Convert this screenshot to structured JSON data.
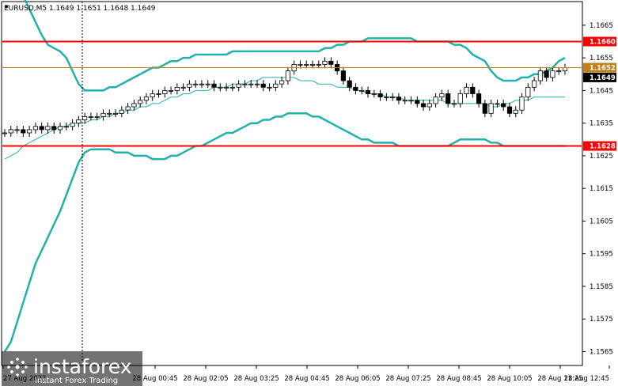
{
  "header": {
    "symbol_info": "EURUSD,M5  1.1649 1.1651 1.1648 1.1649"
  },
  "watermark": {
    "brand": "instaforex",
    "tagline": "Instant Forex Trading"
  },
  "colors": {
    "background": "#ffffff",
    "candle": "#000000",
    "bollinger": "#20b2aa",
    "moving_average": "#20b2aa",
    "level_line": "#ff0000",
    "current_price_line": "#c0801a",
    "grid_tick": "#000000",
    "price_box_text": "#ffffff",
    "current_box_bg": "#000000"
  },
  "chart_data": {
    "type": "candlestick",
    "symbol": "EURUSD",
    "timeframe": "M5",
    "ylim": [
      1.1561,
      1.1672
    ],
    "y_ticks": [
      "1.1665",
      "1.1655",
      "1.1645",
      "1.1635",
      "1.1625",
      "1.1615",
      "1.1605",
      "1.1595",
      "1.1585",
      "1.1575",
      "1.1565"
    ],
    "x_tick_labels": [
      "27 Aug 2022",
      "28 Aug 00:45",
      "28 Aug 02:05",
      "28 Aug 03:25",
      "28 Aug 04:45",
      "28 Aug 06:05",
      "28 Aug 07:25",
      "28 Aug 08:45",
      "28 Aug 10:05",
      "28 Aug 11:25",
      "28 Aug 12:45"
    ],
    "levels": [
      {
        "label": "1.1660",
        "value": 1.166
      },
      {
        "label": "1.1628",
        "value": 1.1628
      }
    ],
    "current_level": {
      "label": "1.1652",
      "value": 1.1652
    },
    "current_price": {
      "label": "1.1649",
      "value": 1.1649
    },
    "close": [
      1.1632,
      1.1633,
      1.1633,
      1.1632,
      1.1633,
      1.1634,
      1.1633,
      1.1634,
      1.1633,
      1.1634,
      1.1634,
      1.1635,
      1.1636,
      1.1637,
      1.1637,
      1.1637,
      1.1638,
      1.1638,
      1.1638,
      1.1639,
      1.164,
      1.1641,
      1.1642,
      1.1643,
      1.1644,
      1.1644,
      1.1645,
      1.1645,
      1.1646,
      1.1646,
      1.1647,
      1.1647,
      1.1647,
      1.1647,
      1.1646,
      1.1646,
      1.1646,
      1.1646,
      1.1647,
      1.1647,
      1.1647,
      1.1647,
      1.1646,
      1.1646,
      1.1647,
      1.1648,
      1.1651,
      1.1653,
      1.1653,
      1.1653,
      1.1653,
      1.1653,
      1.1654,
      1.1653,
      1.1651,
      1.1648,
      1.1646,
      1.1645,
      1.1645,
      1.1644,
      1.1644,
      1.1643,
      1.1643,
      1.1643,
      1.1642,
      1.1642,
      1.1642,
      1.1641,
      1.164,
      1.1641,
      1.1643,
      1.1644,
      1.1641,
      1.1641,
      1.1644,
      1.1646,
      1.1644,
      1.1641,
      1.1638,
      1.1641,
      1.1641,
      1.164,
      1.1638,
      1.1639,
      1.1643,
      1.1646,
      1.1648,
      1.1651,
      1.1649,
      1.1651,
      1.1651,
      1.1652
    ],
    "middle_band": [
      1.1624,
      1.1625,
      1.1626,
      1.1628,
      1.1629,
      1.163,
      1.1631,
      1.1632,
      1.1633,
      1.1634,
      1.1634,
      1.1635,
      1.1635,
      1.1635,
      1.1636,
      1.1636,
      1.1637,
      1.1637,
      1.1638,
      1.1638,
      1.1639,
      1.1639,
      1.164,
      1.164,
      1.1641,
      1.1641,
      1.1642,
      1.1643,
      1.1643,
      1.1644,
      1.1644,
      1.1645,
      1.1645,
      1.1645,
      1.1646,
      1.1646,
      1.1646,
      1.1647,
      1.1647,
      1.1647,
      1.1648,
      1.1648,
      1.1649,
      1.1649,
      1.1649,
      1.1649,
      1.1649,
      1.1649,
      1.1648,
      1.1648,
      1.1648,
      1.1647,
      1.1647,
      1.1647,
      1.1646,
      1.1646,
      1.1646,
      1.1645,
      1.1645,
      1.1644,
      1.1644,
      1.1644,
      1.1643,
      1.1643,
      1.1643,
      1.1642,
      1.1642,
      1.1642,
      1.1642,
      1.1642,
      1.1642,
      1.1642,
      1.1641,
      1.1641,
      1.1641,
      1.1641,
      1.1641,
      1.1641,
      1.1641,
      1.164,
      1.164,
      1.1641,
      1.1641,
      1.1642,
      1.1642,
      1.1642,
      1.1643,
      1.1643,
      1.1643,
      1.1643,
      1.1643,
      1.1643
    ],
    "upper_band": [
      1.1683,
      1.1682,
      1.1678,
      1.1674,
      1.167,
      1.1666,
      1.1662,
      1.1659,
      1.1658,
      1.1657,
      1.1655,
      1.1651,
      1.1647,
      1.1645,
      1.1645,
      1.1645,
      1.1645,
      1.1646,
      1.1646,
      1.1647,
      1.1648,
      1.1649,
      1.165,
      1.1651,
      1.1652,
      1.1652,
      1.1653,
      1.1654,
      1.1654,
      1.1655,
      1.1655,
      1.1656,
      1.1656,
      1.1656,
      1.1656,
      1.1656,
      1.1656,
      1.1657,
      1.1657,
      1.1657,
      1.1657,
      1.1657,
      1.1657,
      1.1657,
      1.1657,
      1.1657,
      1.1657,
      1.1657,
      1.1657,
      1.1657,
      1.1657,
      1.1657,
      1.1658,
      1.1658,
      1.1659,
      1.1659,
      1.166,
      1.166,
      1.166,
      1.1661,
      1.1661,
      1.1661,
      1.1661,
      1.1661,
      1.1661,
      1.1661,
      1.1661,
      1.166,
      1.166,
      1.166,
      1.166,
      1.166,
      1.166,
      1.1659,
      1.1659,
      1.1658,
      1.1656,
      1.1655,
      1.1654,
      1.1651,
      1.1649,
      1.1648,
      1.1648,
      1.1648,
      1.1649,
      1.1649,
      1.165,
      1.165,
      1.1651,
      1.1652,
      1.1654,
      1.1655
    ],
    "lower_band": [
      1.1565,
      1.1568,
      1.1574,
      1.158,
      1.1586,
      1.1592,
      1.1596,
      1.16,
      1.1604,
      1.1608,
      1.1613,
      1.1618,
      1.1623,
      1.1626,
      1.1627,
      1.1627,
      1.1627,
      1.1627,
      1.1626,
      1.1626,
      1.1626,
      1.1625,
      1.1625,
      1.1625,
      1.1624,
      1.1624,
      1.1624,
      1.1625,
      1.1625,
      1.1626,
      1.1627,
      1.1628,
      1.1628,
      1.1629,
      1.163,
      1.1631,
      1.1632,
      1.1632,
      1.1633,
      1.1634,
      1.1635,
      1.1635,
      1.1636,
      1.1636,
      1.1637,
      1.1637,
      1.1638,
      1.1638,
      1.1638,
      1.1638,
      1.1637,
      1.1637,
      1.1636,
      1.1635,
      1.1634,
      1.1633,
      1.1632,
      1.1631,
      1.163,
      1.163,
      1.1629,
      1.1629,
      1.1629,
      1.1629,
      1.1628,
      1.1628,
      1.1628,
      1.1628,
      1.1628,
      1.1628,
      1.1628,
      1.1628,
      1.1628,
      1.1629,
      1.163,
      1.163,
      1.163,
      1.163,
      1.163,
      1.1629,
      1.1629,
      1.1628,
      1.1628,
      1.1628,
      1.1628,
      1.1628,
      1.1628,
      1.1628,
      1.1628,
      1.1628,
      1.1628,
      1.1628
    ]
  }
}
